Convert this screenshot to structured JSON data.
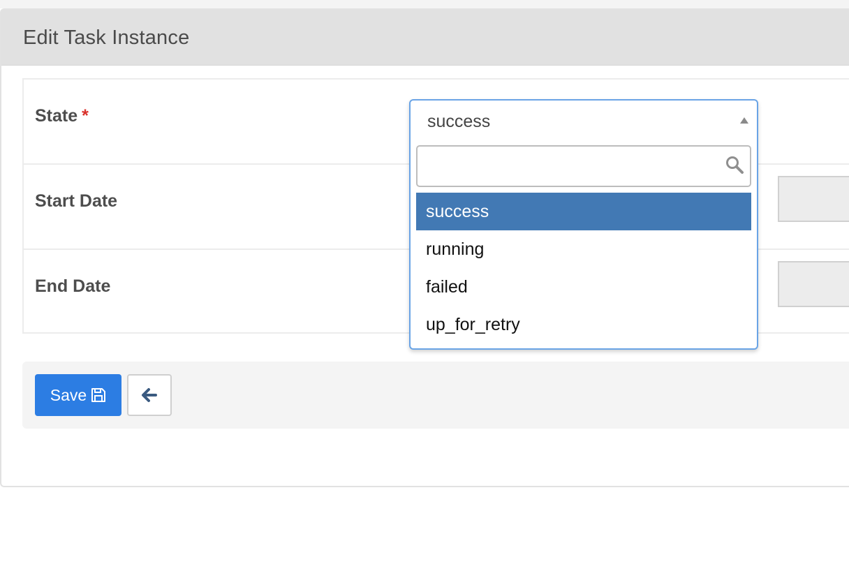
{
  "panel": {
    "title": "Edit Task Instance"
  },
  "form": {
    "rows": [
      {
        "label": "State",
        "required_marker": "*"
      },
      {
        "label": "Start Date"
      },
      {
        "label": "End Date"
      }
    ]
  },
  "state_select": {
    "selected_value": "success",
    "search_placeholder": "",
    "options": [
      "success",
      "running",
      "failed",
      "up_for_retry"
    ],
    "highlighted_option": "success"
  },
  "footer": {
    "save_label": "Save",
    "save_icon": "floppy-disk-icon",
    "back_icon": "arrow-left-icon"
  },
  "colors": {
    "primary_button": "#2c7de3",
    "option_highlight": "#4279b4",
    "required": "#d9312b",
    "focus_border": "#6aa4e6"
  }
}
